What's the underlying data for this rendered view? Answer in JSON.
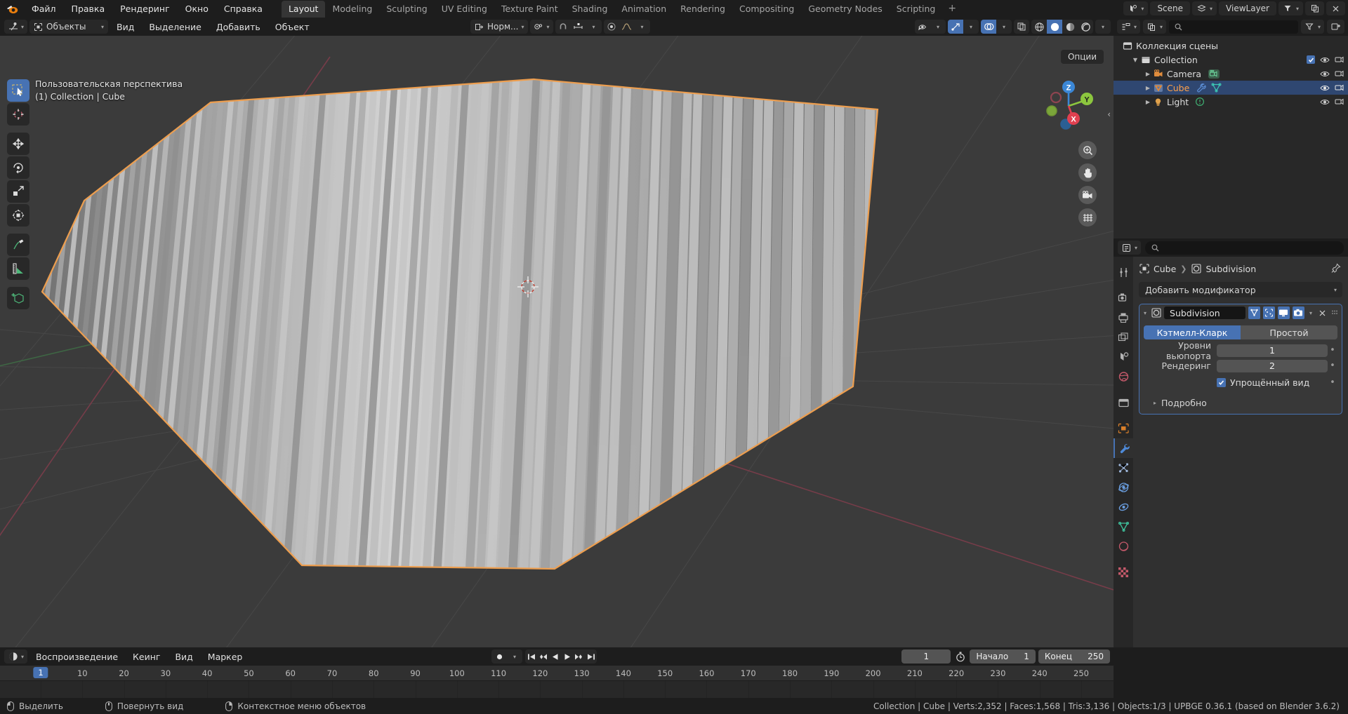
{
  "app": {
    "logo_icon": "blender-logo-icon"
  },
  "topbar": {
    "menus": [
      "Файл",
      "Правка",
      "Рендеринг",
      "Окно",
      "Справка"
    ],
    "workspaces": [
      {
        "label": "Layout",
        "active": true
      },
      {
        "label": "Modeling",
        "active": false
      },
      {
        "label": "Sculpting",
        "active": false
      },
      {
        "label": "UV Editing",
        "active": false
      },
      {
        "label": "Texture Paint",
        "active": false
      },
      {
        "label": "Shading",
        "active": false
      },
      {
        "label": "Animation",
        "active": false
      },
      {
        "label": "Rendering",
        "active": false
      },
      {
        "label": "Compositing",
        "active": false
      },
      {
        "label": "Geometry Nodes",
        "active": false
      },
      {
        "label": "Scripting",
        "active": false
      }
    ],
    "add_workspace_label": "+",
    "scene_label": "Scene",
    "viewlayer_label": "ViewLayer"
  },
  "viewport": {
    "mode_label": "Объекты",
    "menus": [
      "Вид",
      "Выделение",
      "Добавить",
      "Объект"
    ],
    "transform_orientation": "Норм...",
    "options_label": "Опции",
    "overlay_line1": "Пользовательская перспектива",
    "overlay_line2": "(1) Collection | Cube",
    "gizmo_axes": [
      "X",
      "Y",
      "Z"
    ],
    "tools": [
      {
        "name": "tweak-tool",
        "active": true
      },
      {
        "name": "cursor-tool",
        "active": false
      },
      {
        "name": "move-tool",
        "active": false
      },
      {
        "name": "rotate-tool",
        "active": false
      },
      {
        "name": "scale-tool",
        "active": false
      },
      {
        "name": "transform-tool",
        "active": false
      },
      {
        "name": "annotate-tool",
        "active": false
      },
      {
        "name": "measure-tool",
        "active": false
      },
      {
        "name": "add-cube-tool",
        "active": false
      }
    ],
    "nav_buttons": [
      "zoom-icon",
      "pan-hand-icon",
      "camera-view-icon",
      "ortho-grid-icon"
    ],
    "shading_modes": [
      "wireframe",
      "solid",
      "material-preview",
      "rendered"
    ],
    "active_shading": "solid"
  },
  "outliner": {
    "search_placeholder": "",
    "rows": [
      {
        "name": "Коллекция сцены",
        "icon": "scene-collection-icon",
        "depth": 0,
        "selected": false,
        "expandable": false,
        "checkbox": false,
        "eye": false,
        "camera": false
      },
      {
        "name": "Collection",
        "icon": "collection-icon",
        "depth": 1,
        "selected": false,
        "expandable": true,
        "checkbox": true,
        "eye": true,
        "camera": true
      },
      {
        "name": "Camera",
        "icon": "camera-object-icon",
        "depth": 2,
        "selected": false,
        "expandable": true,
        "checkbox": false,
        "eye": true,
        "camera": true
      },
      {
        "name": "Cube",
        "icon": "mesh-object-icon",
        "depth": 2,
        "selected": true,
        "expandable": true,
        "checkbox": false,
        "eye": true,
        "camera": true
      },
      {
        "name": "Light",
        "icon": "light-object-icon",
        "depth": 2,
        "selected": false,
        "expandable": true,
        "checkbox": false,
        "eye": true,
        "camera": true
      }
    ]
  },
  "properties": {
    "breadcrumb_object": "Cube",
    "breadcrumb_modifier": "Subdivision",
    "add_modifier_label": "Добавить модификатор",
    "modifier": {
      "name": "Subdivision",
      "type_options": [
        {
          "label": "Кэтмелл-Кларк",
          "active": true
        },
        {
          "label": "Простой",
          "active": false
        }
      ],
      "fields": [
        {
          "label": "Уровни вьюпорта",
          "value": "1"
        },
        {
          "label": "Рендеринг",
          "value": "2"
        }
      ],
      "checkbox_label": "Упрощённый вид",
      "checkbox_checked": true,
      "subpanel_label": "Подробно",
      "display_toggles": [
        {
          "name": "edit-mode-on-cage-toggle",
          "on": true
        },
        {
          "name": "edit-mode-display-toggle",
          "on": true
        },
        {
          "name": "realtime-display-toggle",
          "on": true
        },
        {
          "name": "render-display-toggle",
          "on": true
        }
      ]
    },
    "tabs": [
      {
        "name": "tool-tab",
        "active": false
      },
      {
        "name": "render-tab",
        "active": false
      },
      {
        "name": "output-tab",
        "active": false
      },
      {
        "name": "view-layer-tab",
        "active": false
      },
      {
        "name": "scene-tab",
        "active": false
      },
      {
        "name": "world-tab",
        "active": false
      },
      {
        "name": "collection-tab",
        "active": false
      },
      {
        "name": "object-tab",
        "active": false
      },
      {
        "name": "modifier-tab",
        "active": true
      },
      {
        "name": "particles-tab",
        "active": false
      },
      {
        "name": "physics-tab",
        "active": false
      },
      {
        "name": "constraints-tab",
        "active": false
      },
      {
        "name": "object-data-tab",
        "active": false
      },
      {
        "name": "material-tab",
        "active": false
      },
      {
        "name": "texture-tab",
        "active": false
      }
    ]
  },
  "timeline": {
    "menus": [
      "Воспроизведение",
      "Кеинг",
      "Вид",
      "Маркер"
    ],
    "current_frame": "1",
    "start_label": "Начало",
    "start_value": "1",
    "end_label": "Конец",
    "end_value": "250",
    "ticks": [
      "1",
      "10",
      "20",
      "30",
      "40",
      "50",
      "60",
      "70",
      "80",
      "90",
      "100",
      "110",
      "120",
      "130",
      "140",
      "150",
      "160",
      "170",
      "180",
      "190",
      "200",
      "210",
      "220",
      "230",
      "240",
      "250"
    ],
    "playhead_label": "1"
  },
  "statusbar": {
    "hints": [
      {
        "icon": "mouse-left-icon",
        "label": "Выделить"
      },
      {
        "icon": "mouse-middle-icon",
        "label": "Повернуть вид"
      },
      {
        "icon": "mouse-right-icon",
        "label": "Контекстное меню объектов"
      }
    ],
    "stats": "Collection | Cube | Verts:2,352 | Faces:1,568 | Tris:3,136 | Objects:1/3 | UPBGE 0.36.1 (based on Blender 3.6.2)"
  },
  "colors": {
    "accent_blue": "#4772b3",
    "selected_orange": "#ffa14b",
    "axis_x": "#e04050",
    "axis_y": "#8cc63e",
    "axis_z": "#3b87d6",
    "bg_dark": "#1d1d1d",
    "bg_viewport": "#3b3b3b"
  }
}
